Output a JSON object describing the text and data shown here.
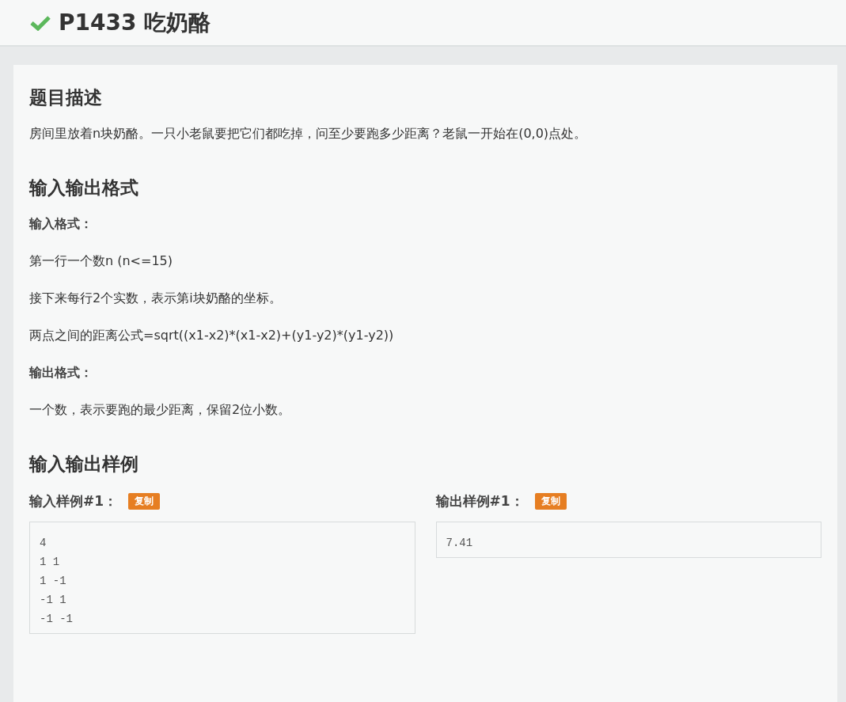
{
  "problem": {
    "solved": true,
    "id": "P1433",
    "title": "吃奶酪"
  },
  "sections": [
    {
      "heading": "题目描述",
      "blocks": [
        {
          "kind": "paragraph",
          "text": "房间里放着n块奶酪。一只小老鼠要把它们都吃掉，问至少要跑多少距离？老鼠一开始在(0,0)点处。"
        }
      ]
    },
    {
      "heading": "输入输出格式",
      "blocks": [
        {
          "kind": "subheading",
          "text": "输入格式："
        },
        {
          "kind": "paragraph",
          "text": "第一行一个数n (n<=15)"
        },
        {
          "kind": "paragraph",
          "text": "接下来每行2个实数，表示第i块奶酪的坐标。"
        },
        {
          "kind": "paragraph",
          "text": "两点之间的距离公式=sqrt((x1-x2)*(x1-x2)+(y1-y2)*(y1-y2))"
        },
        {
          "kind": "subheading",
          "text": "输出格式："
        },
        {
          "kind": "paragraph",
          "text": "一个数，表示要跑的最少距离，保留2位小数。"
        }
      ]
    }
  ],
  "samples_heading": "输入输出样例",
  "samples": [
    {
      "label": "输入样例#1：",
      "copy_button": "复制",
      "lines": [
        "4",
        "1 1",
        "1 -1",
        "-1 1",
        "-1 -1"
      ]
    },
    {
      "label": "输出样例#1：",
      "copy_button": "复制",
      "lines": [
        "7.41"
      ]
    }
  ]
}
